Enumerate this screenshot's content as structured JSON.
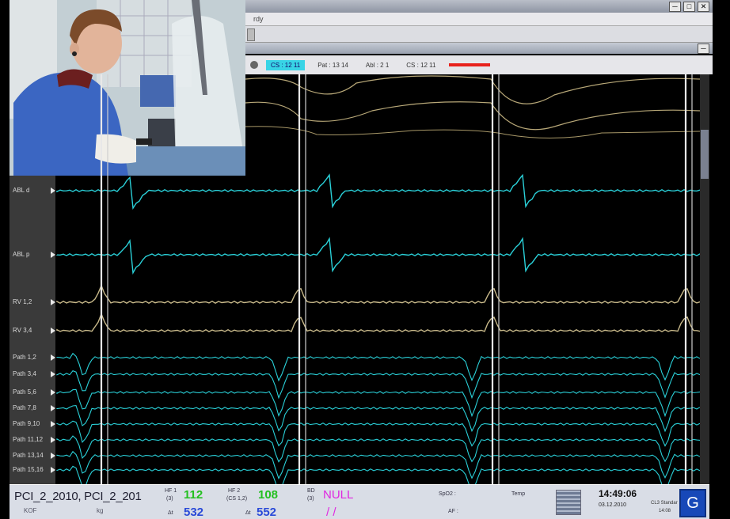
{
  "window": {
    "menu": [
      "rdy"
    ],
    "buttons": [
      "─",
      "□",
      "✕"
    ]
  },
  "statusline": {
    "cs_highlight": "CS : 12 11",
    "fields": [
      "Pat : 13 14",
      "Abl : 2 1",
      "CS : 12 11"
    ],
    "red_highlight": "",
    "sync_icon": "gear-icon"
  },
  "channels": [
    {
      "label": "ABL d",
      "color": "#2ad0d8"
    },
    {
      "label": "ABL p",
      "color": "#2ad0d8"
    },
    {
      "label": "RV 1,2",
      "color": "#c8b98a"
    },
    {
      "label": "RV 3,4",
      "color": "#c8b98a"
    },
    {
      "label": "Path 1,2",
      "color": "#2ad0d8"
    },
    {
      "label": "Path 3,4",
      "color": "#2ad0d8"
    },
    {
      "label": "Path 5,6",
      "color": "#2ad0d8"
    },
    {
      "label": "Path 7,8",
      "color": "#2ad0d8"
    },
    {
      "label": "Path 9,10",
      "color": "#2ad0d8"
    },
    {
      "label": "Path 11,12",
      "color": "#2ad0d8"
    },
    {
      "label": "Path 13,14",
      "color": "#2ad0d8"
    },
    {
      "label": "Path 15,16",
      "color": "#2ad0d8"
    }
  ],
  "bottom": {
    "patient": "PCI_2_2010, PCI_2_201",
    "patient_sub1": "KOF",
    "patient_sub2": "kg",
    "hr1": {
      "label": "HF 1",
      "unit": "(3)",
      "value": "112",
      "interval_label": "Δt",
      "interval": "532"
    },
    "hr2": {
      "label": "HF 2",
      "unit": "(CS 1,2)",
      "value": "108",
      "interval_label": "Δt",
      "interval": "552"
    },
    "bd": {
      "label1": "BD",
      "label2": "(3)",
      "value": "NULL",
      "value2": "/ /"
    },
    "spo2": {
      "label": "SpO2 :",
      "sub": "AF :"
    },
    "temp": {
      "label": "Temp"
    },
    "clock": "14:49:06",
    "date": "03.12.2010",
    "clock_sub": "CL3 Standar",
    "clock_sub2": "14:08",
    "logo_icon": "G"
  },
  "colors": {
    "hr1": "#24c020",
    "hr2": "#24c020",
    "interval": "#2a4ad8",
    "bd": "#e028e0"
  }
}
